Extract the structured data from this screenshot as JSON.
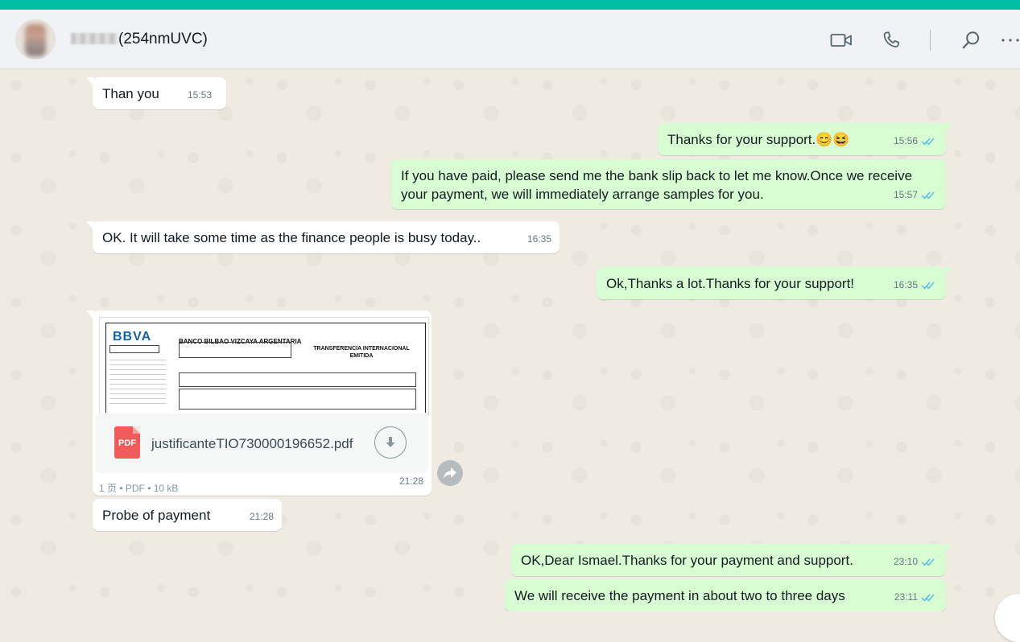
{
  "header": {
    "contact_suffix": "(254nmUVC)"
  },
  "messages": [
    {
      "text": "Than you",
      "time": "15:53"
    },
    {
      "text": "Thanks for your support.😊😆",
      "time": "15:56"
    },
    {
      "line1": "If you have paid, please send me the bank slip back to let me know.Once we receive",
      "line2": "your payment, we will immediately arrange samples for you.",
      "time": "15:57"
    },
    {
      "text": "OK. It will take some time as the finance people is busy today..",
      "time": "16:35"
    },
    {
      "text": "Ok,Thanks a lot.Thanks for your support!",
      "time": "16:35"
    },
    {
      "text": "Probe of payment",
      "time": "21:28"
    },
    {
      "text": "OK,Dear Ismael.Thanks for your payment and support.",
      "time": "23:10"
    },
    {
      "text": "We will receive the payment in about two to three days",
      "time": "23:11"
    }
  ],
  "document": {
    "filename": "justificanteTIO730000196652.pdf",
    "icon_label": "PDF",
    "info": "1 页 • PDF • 10 kB",
    "time": "21:28",
    "preview": {
      "logo": "BBVA",
      "bank_name": "BANCO BILBAO VIZCAYA ARGENTARIA",
      "doc_title_1": "TRANSFERENCIA INTERNACIONAL",
      "doc_title_2": "EMITIDA"
    }
  },
  "colors": {
    "accent": "#00bfa5",
    "incoming": "#ffffff",
    "outgoing": "#d9fdd3",
    "read_ticks": "#53bdeb"
  }
}
